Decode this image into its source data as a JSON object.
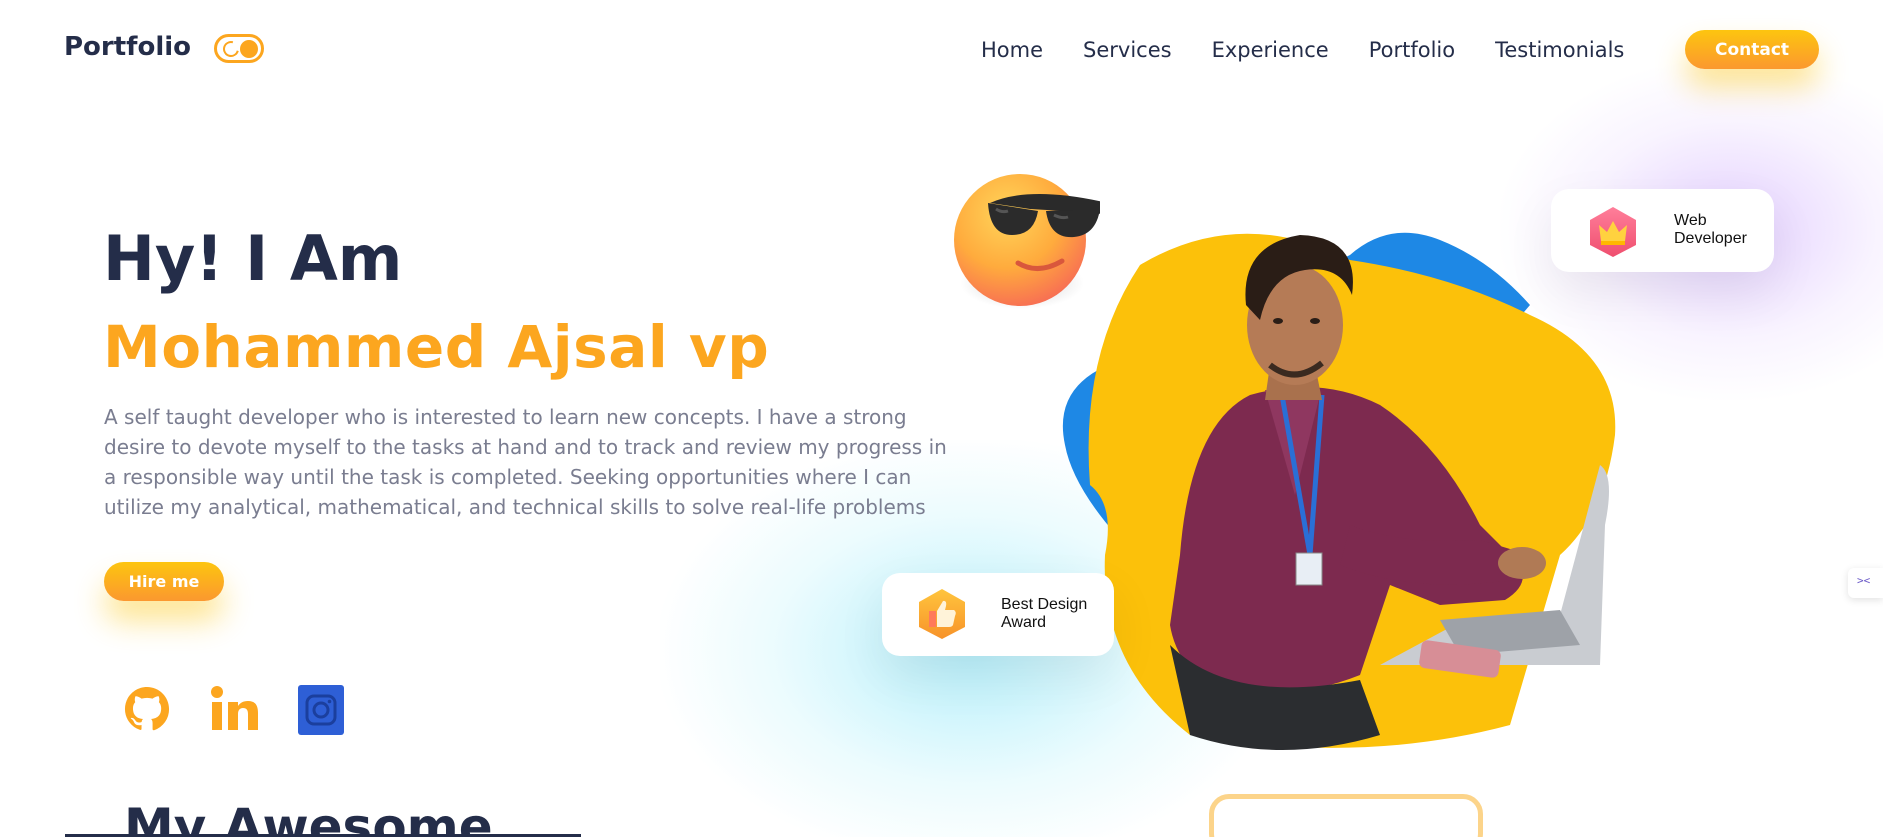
{
  "navbar": {
    "brand": "Portfolio",
    "theme_toggle_icon": "moon-sun-toggle-icon",
    "links": [
      "Home",
      "Services",
      "Experience",
      "Portfolio",
      "Testimonials"
    ],
    "contact_label": "Contact"
  },
  "hero": {
    "greeting": "Hy! I Am",
    "name": "Mohammed Ajsal vp",
    "description": "A self taught developer who is interested to learn new concepts. I have a strong desire to devote myself to the tasks at hand and to track and review my progress in a responsible way until the task is completed. Seeking opportunities where I can utilize my analytical, mathematical, and technical skills to solve real-life problems",
    "hire_label": "Hire me",
    "social_icons": [
      "github-icon",
      "linkedin-icon",
      "instagram-icon"
    ]
  },
  "badges": {
    "web": {
      "label_line1": "Web",
      "label_line2": "Developer",
      "icon": "crown-icon"
    },
    "award": {
      "label_line1": "Best Design",
      "label_line2": "Award",
      "icon": "thumbs-up-icon"
    }
  },
  "visuals": {
    "emoji": "sunglasses-emoji-icon",
    "photo": "developer-photo"
  },
  "next_section": {
    "title": "My Awesome"
  },
  "colors": {
    "accent": "#fca61f",
    "text_dark": "#242d49",
    "text_muted": "#7a7d90",
    "blob_yellow": "#fcc10a",
    "blob_blue": "#1e88e5",
    "instagram_blue": "#2e5fd6"
  }
}
